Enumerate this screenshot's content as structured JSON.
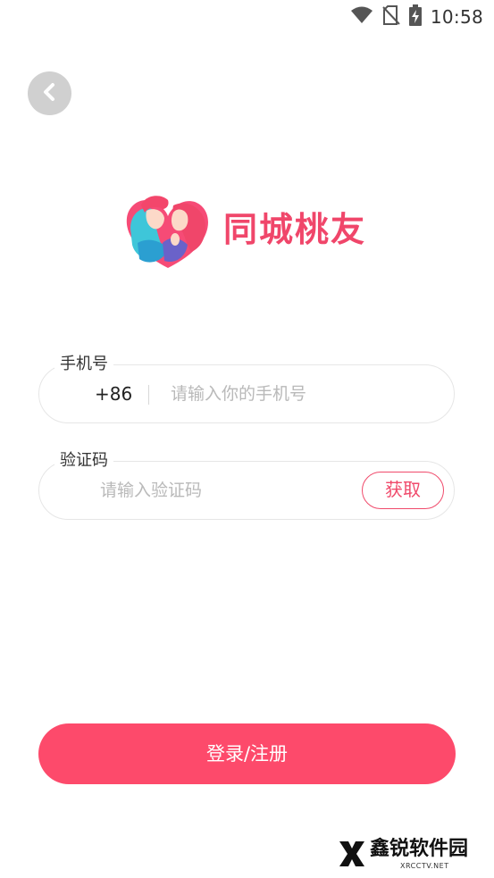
{
  "status_bar": {
    "time": "10:58",
    "icons": [
      "wifi-icon",
      "no-sim-icon",
      "battery-charging-icon"
    ]
  },
  "header": {
    "back_icon": "chevron-left-icon"
  },
  "logo": {
    "app_name": "同城桃友",
    "brand_color": "#f0466a"
  },
  "form": {
    "phone": {
      "label": "手机号",
      "country_code": "+86",
      "placeholder": "请输入你的手机号",
      "value": ""
    },
    "code": {
      "label": "验证码",
      "placeholder": "请输入验证码",
      "value": "",
      "get_code_label": "获取"
    }
  },
  "actions": {
    "login_label": "登录/注册",
    "login_color": "#fd4a6b"
  },
  "watermark": {
    "text": "鑫锐软件园",
    "sub": "XRCCTV.NET"
  }
}
